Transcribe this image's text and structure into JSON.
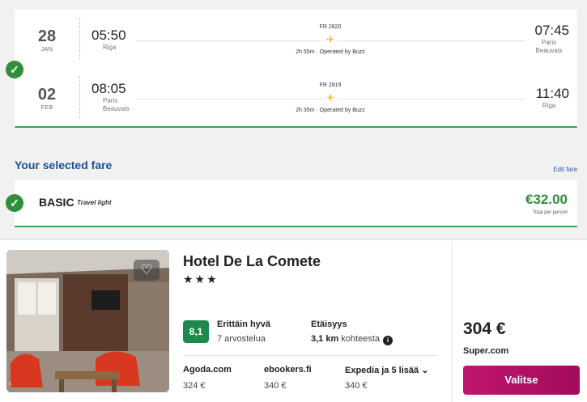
{
  "flights": {
    "outbound": {
      "day": "28",
      "month": "JAN",
      "dep_time": "05:50",
      "dep_city": "Riga",
      "flight_no": "FR 2820",
      "duration": "2h 55m · Operated by Buzz",
      "arr_time": "07:45",
      "arr_city_1": "Paris",
      "arr_city_2": "Beauvais"
    },
    "inbound": {
      "day": "02",
      "month": "FEB",
      "dep_time": "08:05",
      "dep_city_1": "Paris",
      "dep_city_2": "Beauvais",
      "flight_no": "FR 2819",
      "duration": "2h 35m · Operated by Buzz",
      "arr_time": "11:40",
      "arr_city": "Riga"
    }
  },
  "fare": {
    "heading": "Your selected fare",
    "edit_label": "Edit fare",
    "name": "BASIC",
    "tag": "Travel light",
    "price": "€32.00",
    "per_person": "Total per person"
  },
  "hotel": {
    "name": "Hotel De La Comete",
    "stars": "★★★",
    "score": "8,1",
    "rating_text": "Erittäin hyvä",
    "reviews": "7 arvostelua",
    "distance_label": "Etäisyys",
    "distance_value": "3,1 km",
    "distance_suffix": "kohteesta",
    "providers": [
      {
        "name": "Agoda.com",
        "price": "324 €"
      },
      {
        "name": "ebookers.fi",
        "price": "340 €"
      },
      {
        "name": "Expedia ja 5 lisää",
        "price": "340 €"
      }
    ],
    "best_price": "304 €",
    "best_supplier": "Super.com",
    "select_label": "Valitse"
  },
  "colors": {
    "green": "#2f8f3a",
    "blue": "#1d4f91",
    "button": "#b5106a",
    "plane": "#f0b400"
  }
}
